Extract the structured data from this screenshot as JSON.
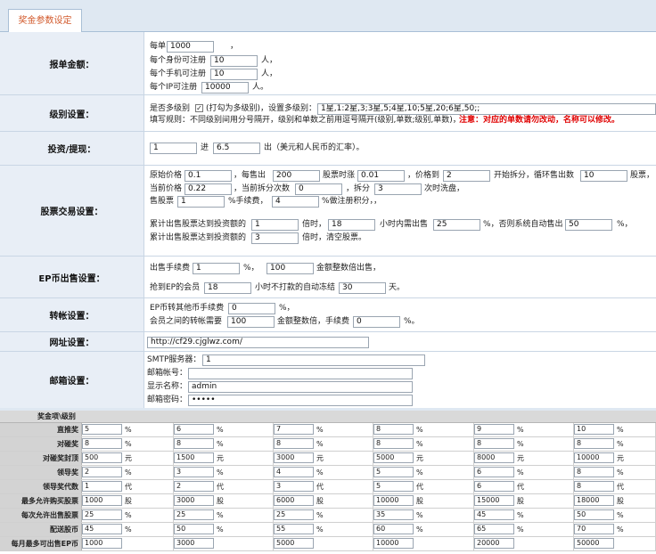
{
  "tab": {
    "label": "奖金参数设定"
  },
  "sections": {
    "order_amount": {
      "label": "报单金额：",
      "per_order_label": "每单",
      "per_order_value": "1000",
      "per_order_suffix": "，",
      "per_id_label": "每个身份可注册",
      "per_id_value": "10",
      "per_id_suffix": "人，",
      "per_phone_label": "每个手机可注册",
      "per_phone_value": "10",
      "per_phone_suffix": "人，",
      "per_ip_label": "每个IP可注册",
      "per_ip_value": "10000",
      "per_ip_suffix": "人。"
    },
    "level": {
      "label": "级别设置：",
      "multi_label": "是否多级别",
      "multi_checked": true,
      "multi_hint": "(打勾为多级别)，设置多级别：",
      "levels_value": "1星,1:2星,3;3星,5;4星,10;5星,20;6星,50;;",
      "rule_text": "填写规则：不同级别间用分号隔开，级别和单数之前用逗号隔开(级别,单数;级别,单数)，",
      "warning": "注意：对应的单数请勿改动，名称可以修改。"
    },
    "invest": {
      "label": "投资/提现：",
      "in_value": "1",
      "in_text": "进",
      "out_value": "6.5",
      "out_text": "出（美元和人民币的汇率）。"
    },
    "stock": {
      "label": "股票交易设置：",
      "orig_price_label": "原始价格",
      "orig_price": "0.1",
      "sell_label": "，每售出",
      "sell_value": "200",
      "rise_label": "股票时涨",
      "rise_value": "0.01",
      "reach_label": "，价格到",
      "reach_value": "2",
      "split_start_label": "开始拆分，循环售出数",
      "loop_value": "10",
      "loop_suffix": "股票，",
      "cur_price_label": "当前价格",
      "cur_price": "0.22",
      "split_count_label": "，当前拆分次数",
      "split_count": "0",
      "split_label": "，拆分",
      "split_value": "3",
      "split_suffix": "次时洗盘，",
      "sell_stock_label": "售股票",
      "sell_fee_value": "1",
      "sell_fee_suffix": "%手续费，",
      "reg_score_value": "4",
      "reg_score_suffix": "%做注册积分，，",
      "cum_label": "累计出售股票达到投资额的",
      "cum_value": "1",
      "times_label": "倍时，",
      "hours_value": "18",
      "hours_label": "小时内需出售",
      "need_value": "25",
      "auto_label": "%，否则系统自动售出",
      "auto_value": "50",
      "auto_suffix": "%，",
      "clear_label": "累计出售股票达到投资额的",
      "clear_value": "3",
      "clear_suffix": "倍时，清空股票。"
    },
    "ep_sell": {
      "label": "EP币出售设置：",
      "fee_label": "出售手续费",
      "fee_value": "1",
      "fee_suffix": "%，",
      "multiple_value": "100",
      "multiple_suffix": "金额整数倍出售，",
      "member_label": "抢到EP的会员",
      "member_value": "18",
      "lock_label": "小时不打款的自动冻结",
      "lock_value": "30",
      "lock_suffix": "天。"
    },
    "transfer": {
      "label": "转帐设置：",
      "ep_label": "EP币转其他币手续费",
      "ep_value": "0",
      "ep_suffix": "%，",
      "member_label": "会员之间的转帐需要",
      "member_value": "100",
      "member_mid": "金额整数倍，手续费",
      "fee_value": "0",
      "fee_suffix": "%。"
    },
    "url": {
      "label": "网址设置：",
      "value": "http://cf29.cjglwz.com/"
    },
    "mail": {
      "label": "邮箱设置：",
      "smtp_label": "SMTP服务器：",
      "smtp_value": "1",
      "account_label": "邮箱帐号：",
      "account_value": "",
      "display_label": "显示名称：",
      "display_value": "admin",
      "password_label": "邮箱密码：",
      "password_value": "•••••"
    }
  },
  "bonus": {
    "header": "奖金项\\级别",
    "rows": [
      {
        "label": "直推奖",
        "unit": "%",
        "values": [
          "5",
          "6",
          "7",
          "8",
          "9",
          "10"
        ]
      },
      {
        "label": "对碰奖",
        "unit": "%",
        "values": [
          "8",
          "8",
          "8",
          "8",
          "8",
          "8"
        ]
      },
      {
        "label": "对碰奖封顶",
        "unit": "元",
        "values": [
          "500",
          "1500",
          "3000",
          "5000",
          "8000",
          "10000"
        ]
      },
      {
        "label": "领导奖",
        "unit": "%",
        "values": [
          "2",
          "3",
          "4",
          "5",
          "6",
          "8"
        ]
      },
      {
        "label": "领导奖代数",
        "unit": "代",
        "values": [
          "1",
          "2",
          "3",
          "5",
          "6",
          "8"
        ]
      },
      {
        "label": "最多允许购买股票",
        "unit": "股",
        "values": [
          "1000",
          "3000",
          "6000",
          "10000",
          "15000",
          "18000"
        ]
      },
      {
        "label": "每次允许出售股票",
        "unit": "%",
        "values": [
          "25",
          "25",
          "25",
          "35",
          "45",
          "50"
        ]
      },
      {
        "label": "配送股币",
        "unit": "%",
        "values": [
          "45",
          "50",
          "55",
          "60",
          "65",
          "70"
        ]
      },
      {
        "label": "每月最多可出售EP币",
        "unit": "",
        "values": [
          "1000",
          "3000",
          "5000",
          "10000",
          "20000",
          "50000"
        ]
      }
    ]
  }
}
